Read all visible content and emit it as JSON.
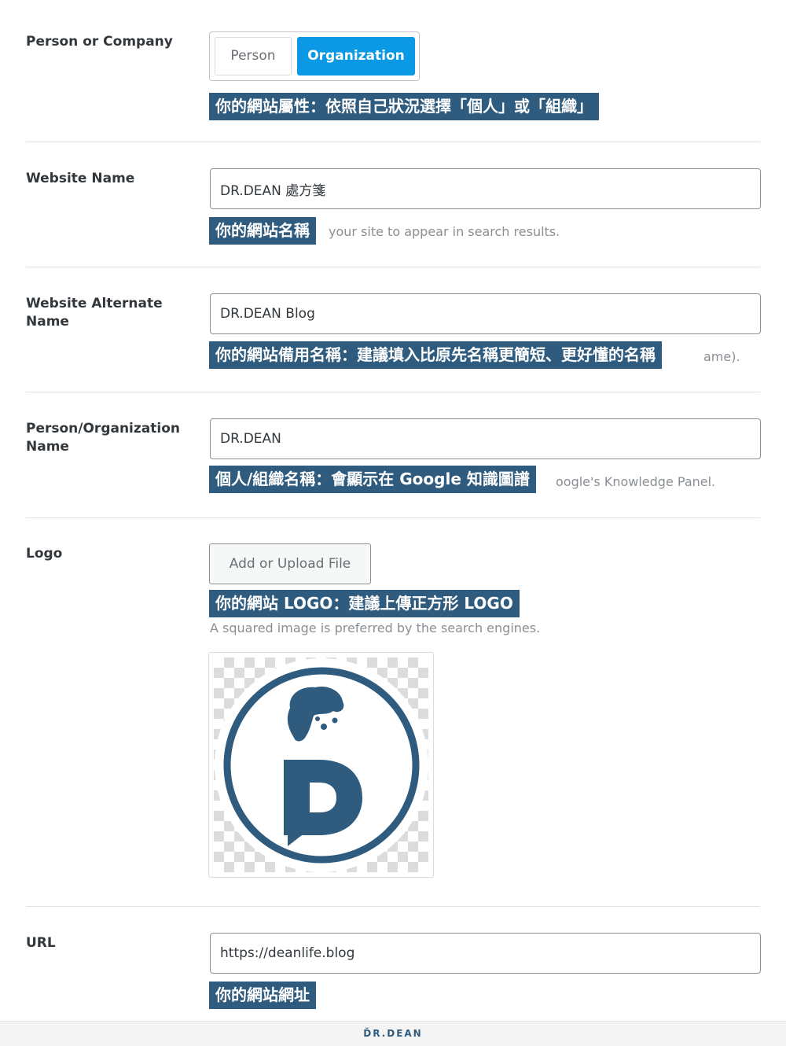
{
  "fields": {
    "person_company": {
      "label": "Person or Company",
      "options": [
        "Person",
        "Organization"
      ],
      "selected": "Organization",
      "note": "你的網站屬性：依照自己狀況選擇「個人」或「組織」"
    },
    "website_name": {
      "label": "Website Name",
      "value": "DR.DEAN 處方箋",
      "desc": "your site to appear in search results.",
      "note": "你的網站名稱"
    },
    "alternate_name": {
      "label": "Website Alternate Name",
      "value": "DR.DEAN Blog",
      "desc": "ame).",
      "note": "你的網站備用名稱：建議填入比原先名稱更簡短、更好懂的名稱"
    },
    "org_name": {
      "label": "Person/Organization Name",
      "value": "DR.DEAN",
      "desc": "oogle's Knowledge Panel.",
      "note": "個人/組織名稱：會顯示在 Google 知識圖譜"
    },
    "logo": {
      "label": "Logo",
      "button": "Add or Upload File",
      "note": "你的網站 LOGO：建議上傳正方形 LOGO",
      "desc": "A squared image is preferred by the search engines."
    },
    "url": {
      "label": "URL",
      "value": "https://deanlife.blog",
      "note": "你的網站網址"
    }
  },
  "footer": {
    "brand": "ĎR.DEAN"
  },
  "colors": {
    "accent": "#0b99e6",
    "overlay": "#2e5b7e"
  }
}
